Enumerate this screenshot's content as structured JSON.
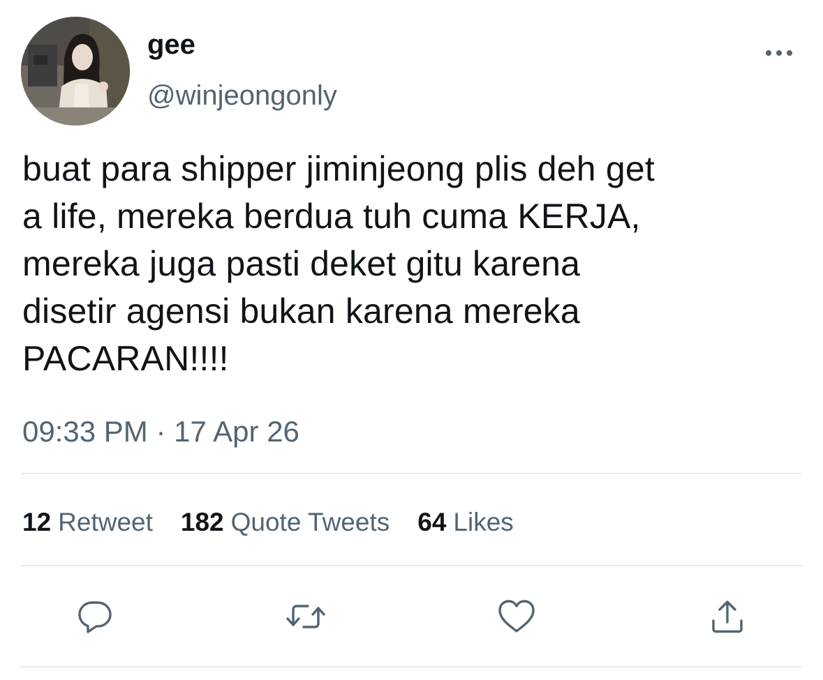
{
  "user": {
    "display_name": "gee",
    "handle": "@winjeongonly"
  },
  "tweet": {
    "text_lines": [
      "buat para shipper jiminjeong plis deh get",
      "a life, mereka berdua tuh cuma KERJA,",
      "mereka juga pasti deket gitu karena",
      "disetir agensi bukan karena mereka",
      "PACARAN!!!!"
    ],
    "timestamp": "09:33 PM · 17 Apr 26"
  },
  "stats": {
    "retweets": {
      "count": "12",
      "label": "Retweet"
    },
    "quotes": {
      "count": "182",
      "label": "Quote Tweets"
    },
    "likes": {
      "count": "64",
      "label": "Likes"
    }
  },
  "icons": {
    "more": "more-horizontal-icon",
    "reply": "reply-icon",
    "retweet": "retweet-icon",
    "like": "heart-icon",
    "share": "share-icon"
  },
  "colors": {
    "text_primary": "#0f1419",
    "text_secondary": "#536471",
    "divider": "#e7e9eb",
    "icon": "#536471"
  }
}
